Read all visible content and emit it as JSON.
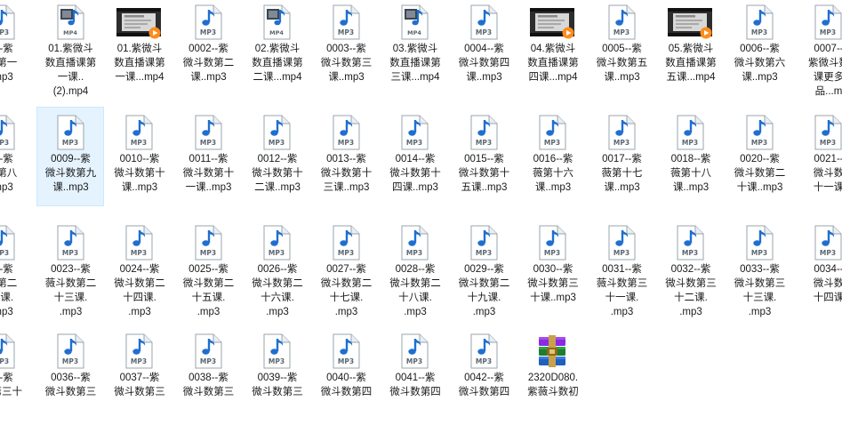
{
  "explorer": {
    "view": "large-icons",
    "accent": "#0078d7",
    "selection_color": "#e5f3ff",
    "items": [
      {
        "type": "mp3",
        "label": "1--紫\n数第一\n.mp3"
      },
      {
        "type": "mp4",
        "label": "01.紫微斗\n数直播课第\n一课..\n(2).mp4"
      },
      {
        "type": "mp4-thumb",
        "label": "01.紫微斗\n数直播课第\n一课...mp4"
      },
      {
        "type": "mp3",
        "label": "0002--紫\n微斗数第二\n课..mp3"
      },
      {
        "type": "mp4",
        "label": "02.紫微斗\n数直播课第\n二课...mp4"
      },
      {
        "type": "mp3",
        "label": "0003--紫\n微斗数第三\n课..mp3"
      },
      {
        "type": "mp4",
        "label": "03.紫微斗\n数直播课第\n三课...mp4"
      },
      {
        "type": "mp3",
        "label": "0004--紫\n微斗数第四\n课..mp3"
      },
      {
        "type": "mp4-thumb",
        "label": "04.紫微斗\n数直播课第\n四课...mp4"
      },
      {
        "type": "mp3",
        "label": "0005--紫\n微斗数第五\n课..mp3"
      },
      {
        "type": "mp4-thumb",
        "label": "05.紫微斗\n数直播课第\n五课...mp4"
      },
      {
        "type": "mp3",
        "label": "0006--紫\n微斗数第六\n课..mp3"
      },
      {
        "type": "mp3",
        "label": "0007--\n紫微斗数\n课更多\n品...m"
      },
      {
        "type": "mp3",
        "label": "8--紫\n数第八\n.mp3"
      },
      {
        "type": "mp3",
        "label": "0009--紫\n微斗数第九\n课..mp3",
        "selected": true
      },
      {
        "type": "mp3",
        "label": "0010--紫\n微斗数第十\n课..mp3"
      },
      {
        "type": "mp3",
        "label": "0011--紫\n微斗数第十\n一课..mp3"
      },
      {
        "type": "mp3",
        "label": "0012--紫\n微斗数第十\n二课..mp3"
      },
      {
        "type": "mp3",
        "label": "0013--紫\n微斗数第十\n三课..mp3"
      },
      {
        "type": "mp3",
        "label": "0014--紫\n微斗数第十\n四课..mp3"
      },
      {
        "type": "mp3",
        "label": "0015--紫\n微斗数第十\n五课..mp3"
      },
      {
        "type": "mp3",
        "label": "0016--紫\n薇第十六\n课..mp3"
      },
      {
        "type": "mp3",
        "label": "0017--紫\n薇第十七\n课..mp3"
      },
      {
        "type": "mp3",
        "label": "0018--紫\n薇第十八\n课..mp3"
      },
      {
        "type": "mp3",
        "label": "0020--紫\n微斗数第二\n十课..mp3"
      },
      {
        "type": "mp3",
        "label": "0021--\n微斗数\n十一课"
      },
      {
        "type": "mp3",
        "label": "2--紫\n数第二\n二课.\n.mp3"
      },
      {
        "type": "mp3",
        "label": "0023--紫\n薇斗数第二\n十三课.\n.mp3"
      },
      {
        "type": "mp3",
        "label": "0024--紫\n微斗数第二\n十四课.\n.mp3"
      },
      {
        "type": "mp3",
        "label": "0025--紫\n微斗数第二\n十五课.\n.mp3"
      },
      {
        "type": "mp3",
        "label": "0026--紫\n微斗数第二\n十六课.\n.mp3"
      },
      {
        "type": "mp3",
        "label": "0027--紫\n微斗数第二\n十七课.\n.mp3"
      },
      {
        "type": "mp3",
        "label": "0028--紫\n微斗数第二\n十八课.\n.mp3"
      },
      {
        "type": "mp3",
        "label": "0029--紫\n微斗数第二\n十九课.\n.mp3"
      },
      {
        "type": "mp3",
        "label": "0030--紫\n微斗数第三\n十课..mp3"
      },
      {
        "type": "mp3",
        "label": "0031--紫\n薇斗数第三\n十一课.\n.mp3"
      },
      {
        "type": "mp3",
        "label": "0032--紫\n微斗数第三\n十二课.\n.mp3"
      },
      {
        "type": "mp3",
        "label": "0033--紫\n微斗数第三\n十三课.\n.mp3"
      },
      {
        "type": "mp3",
        "label": "0034--\n微斗数\n十四课"
      },
      {
        "type": "mp3",
        "label": "5--紫\n数第三十"
      },
      {
        "type": "mp3",
        "label": "0036--紫\n微斗数第三"
      },
      {
        "type": "mp3",
        "label": "0037--紫\n微斗数第三"
      },
      {
        "type": "mp3",
        "label": "0038--紫\n微斗数第三"
      },
      {
        "type": "mp3",
        "label": "0039--紫\n微斗数第三"
      },
      {
        "type": "mp3",
        "label": "0040--紫\n微斗数第四"
      },
      {
        "type": "mp3",
        "label": "0041--紫\n微斗数第四"
      },
      {
        "type": "mp3",
        "label": "0042--紫\n微斗数第四"
      },
      {
        "type": "rar",
        "label": "2320D080.\n紫薇斗数初"
      }
    ]
  }
}
